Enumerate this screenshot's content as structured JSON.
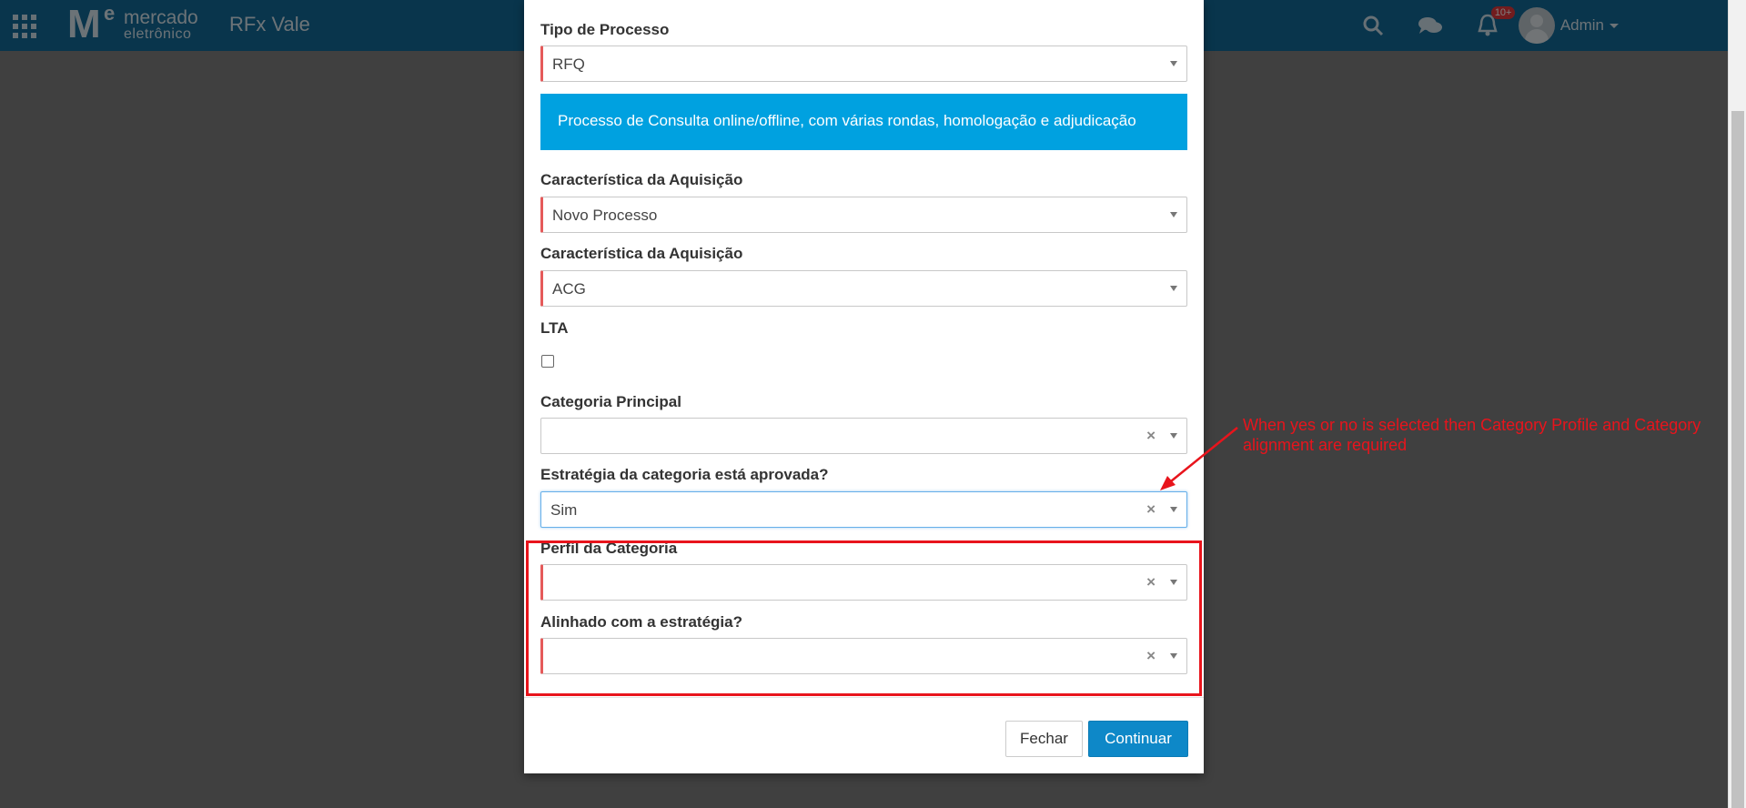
{
  "app": {
    "brand_top": "mercado",
    "brand_bottom": "eletrônico",
    "title": "RFx Vale",
    "user": "Admin",
    "notifications": "10+"
  },
  "modal": {
    "fields": [
      {
        "label": "Tipo de Processo",
        "value": "RFQ"
      },
      {
        "label": "Característica da Aquisição",
        "value": "Novo Processo"
      },
      {
        "label": "Característica da Aquisição",
        "value": "ACG"
      },
      {
        "label": "LTA"
      },
      {
        "label": "Categoria Principal",
        "value": ""
      },
      {
        "label": "Estratégia da categoria está aprovada?",
        "value": "Sim"
      },
      {
        "label": "Perfil da Categoria",
        "value": ""
      },
      {
        "label": "Alinhado com a estratégia?",
        "value": ""
      }
    ],
    "info_text": "Processo de Consulta online/offline, com várias rondas, homologação e adjudicação",
    "buttons": {
      "close": "Fechar",
      "continue": "Continuar"
    }
  },
  "annotation": {
    "text": "When yes or no is selected then Category Profile and Category alignment are required"
  },
  "colors": {
    "navbar": "#136a99",
    "info": "#00a1e0",
    "primary_button": "#0e88c8",
    "annotation_red": "#e8141c",
    "required_mark": "#e55a5a"
  }
}
